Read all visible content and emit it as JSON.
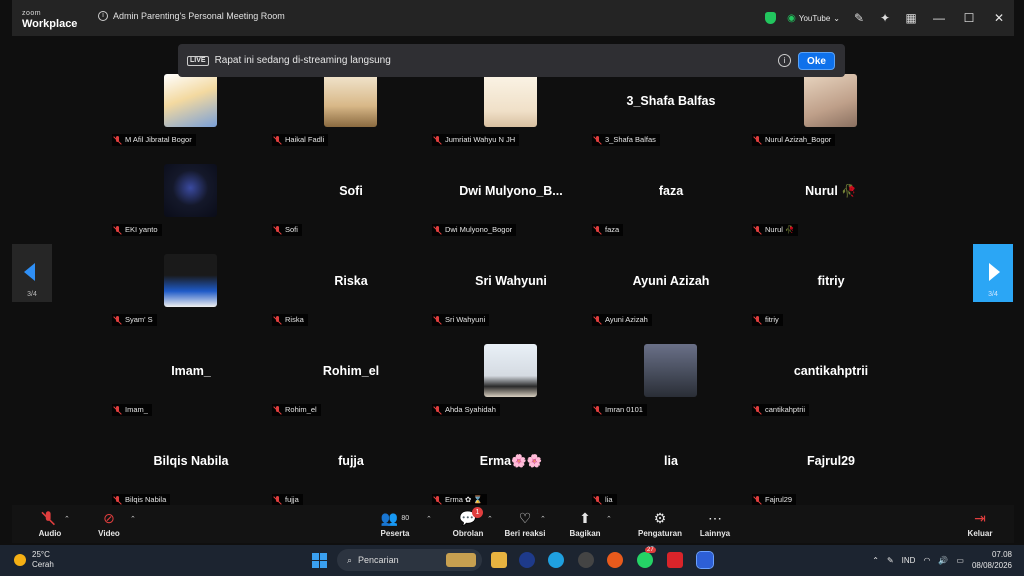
{
  "window": {
    "brand_top": "zoom",
    "brand_bottom": "Workplace",
    "meeting_title": "Admin Parenting's Personal Meeting Room",
    "stream_target": "YouTube"
  },
  "banner": {
    "live_tag": "LIVE",
    "message": "Rapat ini sedang di-streaming langsung",
    "ok_label": "Oke"
  },
  "participants": [
    {
      "display": "",
      "label": "M Afil Jibratal Bogor",
      "avatar": "anime"
    },
    {
      "display": "",
      "label": "Haikal Fadli",
      "avatar": "mosque"
    },
    {
      "display": "",
      "label": "Jumriati Wahyu N JH",
      "avatar": "family"
    },
    {
      "display": "3_Shafa Balfas",
      "label": "3_Shafa Balfas",
      "avatar": ""
    },
    {
      "display": "",
      "label": "Nurul Azizah_Bogor",
      "avatar": "hijab"
    },
    {
      "display": "",
      "label": "EKI yanto",
      "avatar": "logo"
    },
    {
      "display": "Sofi",
      "label": "Sofi",
      "avatar": ""
    },
    {
      "display": "Dwi Mulyono_B...",
      "label": "Dwi Mulyono_Bogor",
      "avatar": ""
    },
    {
      "display": "faza",
      "label": "faza",
      "avatar": ""
    },
    {
      "display": "Nurul 🥀",
      "label": "Nurul 🥀",
      "avatar": ""
    },
    {
      "display": "",
      "label": "Syam' S",
      "avatar": "man"
    },
    {
      "display": "Riska",
      "label": "Riska",
      "avatar": ""
    },
    {
      "display": "Sri Wahyuni",
      "label": "Sri Wahyuni",
      "avatar": ""
    },
    {
      "display": "Ayuni Azizah",
      "label": "Ayuni Azizah",
      "avatar": ""
    },
    {
      "display": "fitriy",
      "label": "fitriy",
      "avatar": ""
    },
    {
      "display": "Imam_",
      "label": "Imam_",
      "avatar": ""
    },
    {
      "display": "Rohim_el",
      "label": "Rohim_el",
      "avatar": ""
    },
    {
      "display": "",
      "label": "Ahda Syahidah",
      "avatar": "kaaba"
    },
    {
      "display": "",
      "label": "Imran 0101",
      "avatar": "photo"
    },
    {
      "display": "cantikahptrii",
      "label": "cantikahptrii",
      "avatar": ""
    },
    {
      "display": "Bilqis Nabila",
      "label": "Bilqis Nabila",
      "avatar": ""
    },
    {
      "display": "fujja",
      "label": "fujja",
      "avatar": ""
    },
    {
      "display": "Erma🌸🌸",
      "label": "Erma ✿ ⌛",
      "avatar": ""
    },
    {
      "display": "lia",
      "label": "lia",
      "avatar": ""
    },
    {
      "display": "Fajrul29",
      "label": "Fajrul29",
      "avatar": ""
    }
  ],
  "pager": {
    "left": "3/4",
    "right": "3/4"
  },
  "toolbar": {
    "audio": "Audio",
    "video": "Video",
    "participants": "Peserta",
    "participants_count": "80",
    "chat": "Obrolan",
    "chat_badge": "1",
    "reactions": "Beri reaksi",
    "share": "Bagikan",
    "settings": "Pengaturan",
    "more": "Lainnya",
    "leave": "Keluar"
  },
  "taskbar": {
    "temp": "25°C",
    "weather": "Cerah",
    "search_placeholder": "Pencarian",
    "lang": "IND",
    "time": "07.08",
    "date": "08/08/2026",
    "wa_badge": "27"
  },
  "colors": {
    "accent": "#0e71eb",
    "mute": "#e03e3e",
    "nav_active": "#2ba6f5"
  }
}
